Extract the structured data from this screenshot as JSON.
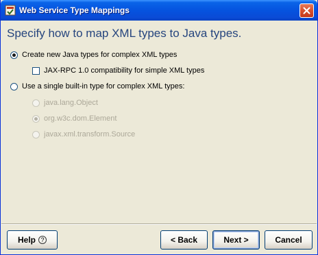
{
  "window": {
    "title": "Web Service Type Mappings",
    "icon": "wizard-app-icon",
    "close_icon": "close-icon"
  },
  "heading": "Specify how to map XML types to Java types.",
  "options": {
    "create_new": {
      "label": "Create new Java types for complex XML types",
      "selected": true,
      "enabled": true
    },
    "jaxrpc": {
      "label": "JAX-RPC 1.0 compatibility for simple XML types",
      "checked": false,
      "enabled": true
    },
    "single_builtin": {
      "label": "Use a single built-in type for complex XML types:",
      "selected": false,
      "enabled": true
    },
    "builtin_types": [
      {
        "label": "java.lang.Object",
        "selected": false,
        "enabled": false
      },
      {
        "label": "org.w3c.dom.Element",
        "selected": true,
        "enabled": false
      },
      {
        "label": "javax.xml.transform.Source",
        "selected": false,
        "enabled": false
      }
    ]
  },
  "buttons": {
    "help": "Help",
    "back": "< Back",
    "next": "Next >",
    "cancel": "Cancel"
  },
  "colors": {
    "title_bar": "#0553DF",
    "heading_text": "#26457E",
    "dialog_bg": "#ECE9D8",
    "close_button": "#D8502E",
    "disabled_text": "#ACA899"
  }
}
